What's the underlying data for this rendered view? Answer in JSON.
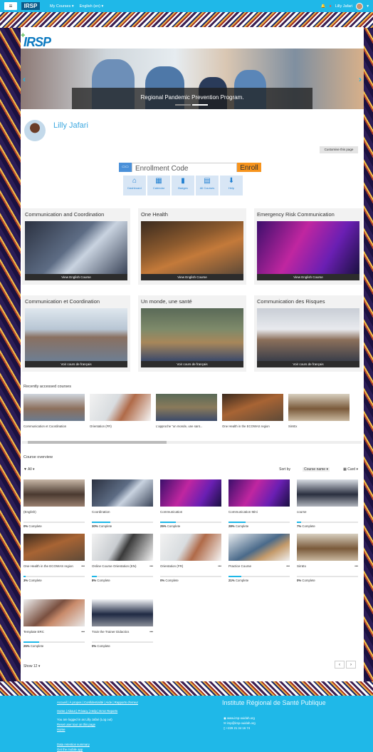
{
  "topbar": {
    "menu": "≡",
    "logo": "IRSP",
    "my_courses": "My Courses ▾",
    "language": "English (en) ▾",
    "user": "Lilly Jafari",
    "caret": "▾"
  },
  "hero": {
    "logo": "IRSP",
    "caption": "Regional Pandemic Prevention Program.",
    "prev": "‹",
    "next": "›"
  },
  "profile": {
    "name": "Lilly Jafari",
    "customise": "Customise this page"
  },
  "enroll": {
    "icon": "▭▭",
    "placeholder": "Enrollment Code",
    "button": "Enroll"
  },
  "shortcuts": [
    {
      "icon": "⌂",
      "label": "Dashboard"
    },
    {
      "icon": "▦",
      "label": "Calendar"
    },
    {
      "icon": "▮",
      "label": "Badges"
    },
    {
      "icon": "▤",
      "label": "All Courses"
    },
    {
      "icon": "⬇",
      "label": "Help"
    }
  ],
  "featured_en": [
    {
      "title": "Communication and Coordination",
      "button": "View English Course"
    },
    {
      "title": "One Health",
      "button": "View English Course"
    },
    {
      "title": "Emergency Risk Communication",
      "button": "View English Course"
    }
  ],
  "featured_fr": [
    {
      "title": "Communication et Coordination",
      "button": "Voir cours de français"
    },
    {
      "title": "Un monde, une santé",
      "button": "Voir cours de français"
    },
    {
      "title": "Communication des Risques",
      "button": "Voir cours de français"
    }
  ],
  "recent": {
    "title": "Recently accessed courses",
    "items": [
      "Communication et Coordination",
      "Orientation (FR)",
      "L'approche \"un monde, une sant...",
      "One Health in the ECOWAS region",
      "SimEx"
    ]
  },
  "overview": {
    "title": "Course overview",
    "filter": "▼ All ▾",
    "sort_label": "Sort by",
    "sort_value": "Course name ▾",
    "view": "▦ Card ▾",
    "courses": [
      {
        "name": "(English)",
        "progress": 0,
        "pct": "0%",
        "suffix": "Complete"
      },
      {
        "name": "Coordination",
        "progress": 30,
        "pct": "30%",
        "suffix": "Complete"
      },
      {
        "name": "Communication",
        "progress": 25,
        "pct": "25%",
        "suffix": "Complete"
      },
      {
        "name": "Communication Mini",
        "progress": 28,
        "pct": "28%",
        "suffix": "Complete"
      },
      {
        "name": "course",
        "progress": 7,
        "pct": "7%",
        "suffix": "Complete"
      },
      {
        "name": "One Health in the ECOWAS region",
        "progress": 3,
        "pct": "3%",
        "suffix": "Complete"
      },
      {
        "name": "Online Course Orientation (EN)",
        "progress": 8,
        "pct": "8%",
        "suffix": "Complete"
      },
      {
        "name": "Orientation (FR)",
        "progress": 0,
        "pct": "0%",
        "suffix": "Complete"
      },
      {
        "name": "Practice Course",
        "progress": 21,
        "pct": "21%",
        "suffix": "Complete"
      },
      {
        "name": "SimEx",
        "progress": 0,
        "pct": "0%",
        "suffix": "Complete"
      },
      {
        "name": "Template ERC",
        "progress": 25,
        "pct": "25%",
        "suffix": "Complete"
      },
      {
        "name": "Train the Trainer Didactics",
        "progress": 0,
        "pct": "0%",
        "suffix": "Complete"
      }
    ],
    "more": "•••",
    "show": "Show 12 ▾",
    "prev": "‹",
    "next": "›"
  },
  "footer": {
    "links1": "Accueil | À propos | Confidentialité | Aide | Rapports d'erreur",
    "links2": "Home | About | Privacy | Help | Error Reports",
    "logged": "You are logged in as Lilly Jafari (Log out)",
    "reset": "Reset user tour on this page",
    "home": "Home",
    "retention": "Data retention summary",
    "mobile": "Get the mobile app",
    "institute": "Institute Régional de Santé Publique",
    "web": "www.irsp-ouidah.org",
    "email": "irsp@irsp-ouidah.org",
    "phone": "+229 21 34 16 74"
  },
  "colors": {
    "accent": "#1fb8e8",
    "enroll": "#f7941d",
    "shortcut_bg": "#d8e6f5"
  }
}
